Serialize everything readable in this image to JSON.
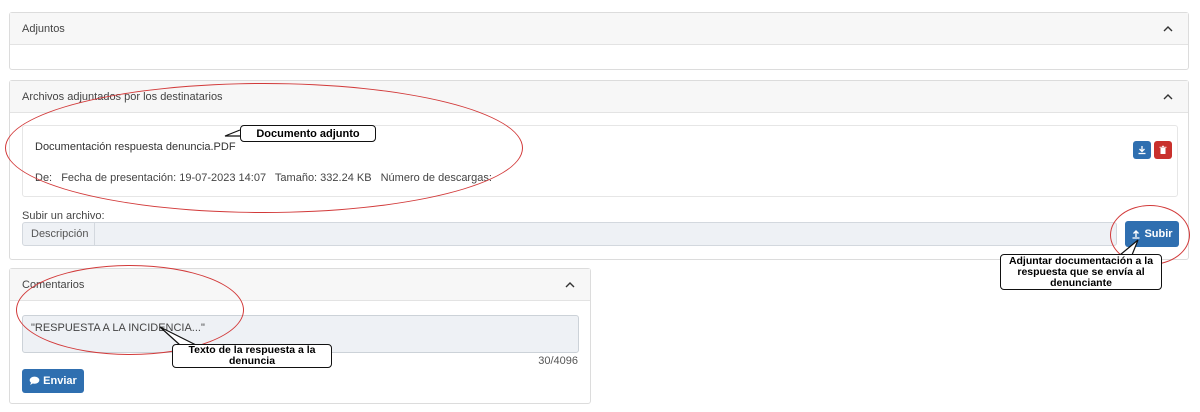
{
  "adjuntos": {
    "title": "Adjuntos"
  },
  "archivos": {
    "title": "Archivos adjuntados por los destinatarios",
    "file": {
      "name": "Documentación respuesta denuncia.PDF",
      "de_label": "De:",
      "fecha": "Fecha de presentación: 19-07-2023 14:07",
      "tamano": "Tamaño: 332.24 KB",
      "descargas": "Número de descargas:"
    },
    "upload": {
      "label": "Subir un archivo:",
      "desc_label": "Descripción",
      "input_value": "",
      "button_label": "Subir"
    }
  },
  "comentarios": {
    "title": "Comentarios",
    "text": "\"RESPUESTA A LA INCIDENCIA...\"",
    "counter": "30/4096",
    "send_label": "Enviar"
  },
  "annotations": {
    "documento": "Documento adjunto",
    "adjuntar": "Adjuntar documentación a la respuesta que se envía al denunciante",
    "texto": "Texto de la respuesta a la denuncia"
  },
  "colors": {
    "primary": "#2f6fb0",
    "danger": "#c9302c",
    "annotation": "#d23a3a"
  },
  "icons": [
    "chevron-up-icon",
    "download-icon",
    "trash-icon",
    "upload-icon",
    "comment-icon"
  ]
}
